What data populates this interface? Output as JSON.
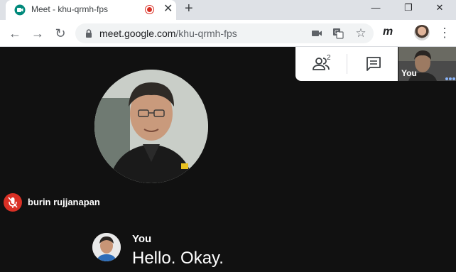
{
  "browser": {
    "tab": {
      "title": "Meet - khu-qrmh-fps",
      "favicon": "google-meet-icon",
      "recording_indicator": "recording-icon",
      "close_label": "✕"
    },
    "new_tab_label": "+",
    "window_controls": {
      "minimize": "—",
      "restore": "❐",
      "close": "✕"
    },
    "toolbar": {
      "back_label": "←",
      "forward_label": "→",
      "reload_label": "↻",
      "url_host": "meet.google.com",
      "url_path": "/khu-qrmh-fps",
      "camera_icon": "camera-icon",
      "translate_icon": "translate-icon",
      "bookmark_label": "☆",
      "extension_label": "m",
      "menu_label": "⋮"
    }
  },
  "meet": {
    "people_count": "2",
    "self_view_label": "You",
    "participant": {
      "name": "burin rujjanapan",
      "mic_status": "muted"
    },
    "caption": {
      "speaker": "You",
      "text": "Hello. Okay."
    }
  },
  "colors": {
    "background": "#111111",
    "accent_red": "#d93025",
    "caption_text": "#ffffff",
    "meet_dots": "#8ab4f8"
  }
}
